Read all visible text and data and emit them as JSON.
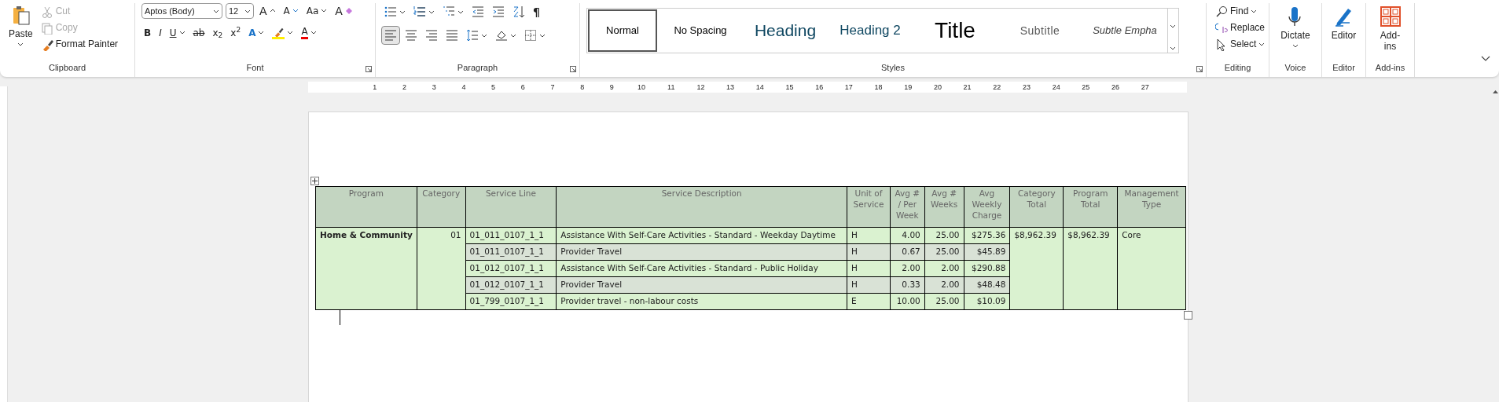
{
  "ribbon": {
    "clipboard": {
      "label": "Clipboard",
      "paste": "Paste",
      "cut": {
        "label": "Cut",
        "disabled": true
      },
      "copy": {
        "label": "Copy",
        "disabled": true
      },
      "format_painter": {
        "label": "Format Painter",
        "disabled": false
      }
    },
    "font": {
      "label": "Font",
      "font_name": "Aptos (Body)",
      "font_size": "12",
      "top_buttons": [
        {
          "kind": "grow",
          "glyph": "A"
        },
        {
          "kind": "shrink",
          "glyph": "A"
        },
        {
          "kind": "case",
          "glyph": "Aa"
        },
        {
          "kind": "clear",
          "glyph": "A"
        }
      ],
      "format_buttons": [
        {
          "kind": "bold",
          "glyph": "B"
        },
        {
          "kind": "italic",
          "glyph": "I"
        },
        {
          "kind": "underline",
          "glyph": "U"
        },
        {
          "kind": "strike",
          "glyph": "ab"
        },
        {
          "kind": "subscript",
          "glyph": "x$_{2}$"
        },
        {
          "kind": "superscript",
          "glyph": "x$^{2}$"
        },
        {
          "kind": "effects",
          "glyph": "A"
        },
        {
          "kind": "highlight"
        },
        {
          "kind": "color",
          "glyph": "A"
        }
      ]
    },
    "paragraph": {
      "label": "Paragraph",
      "pilcrow": "¶",
      "alignment": [
        {
          "kind": "left",
          "selected": true
        },
        {
          "kind": "center",
          "selected": false
        },
        {
          "kind": "right",
          "selected": false
        },
        {
          "kind": "justify",
          "selected": false
        }
      ]
    },
    "styles": {
      "label": "Styles",
      "items": [
        {
          "kind": "normal",
          "label": "Normal",
          "selected": true
        },
        {
          "kind": "no_spacing",
          "label": "No Spacing",
          "selected": false
        },
        {
          "kind": "heading1",
          "label": "Heading",
          "selected": false
        },
        {
          "kind": "heading2",
          "label": "Heading 2",
          "selected": false
        },
        {
          "kind": "title",
          "label": "Title",
          "selected": false
        },
        {
          "kind": "subtitle",
          "label": "Subtitle",
          "selected": false
        },
        {
          "kind": "subtle_emphasis",
          "label": "Subtle Empha",
          "selected": false
        }
      ]
    },
    "editing": {
      "label": "Editing",
      "items": [
        {
          "kind": "find",
          "label": "Find"
        },
        {
          "kind": "replace",
          "label": "Replace"
        },
        {
          "kind": "select",
          "label": "Select"
        }
      ]
    },
    "voice": {
      "label": "Voice",
      "button": "Dictate"
    },
    "editor": {
      "label": "Editor",
      "button": "Editor"
    },
    "addins": {
      "label": "Add-ins",
      "button": "Add-ins"
    }
  },
  "ruler": {
    "numbers": [
      "1",
      "2",
      "3",
      "4",
      "5",
      "6",
      "7",
      "8",
      "9",
      "10",
      "11",
      "12",
      "13",
      "14",
      "15",
      "16",
      "17",
      "18",
      "19",
      "20",
      "21",
      "22",
      "23",
      "24",
      "25",
      "26",
      "27"
    ]
  },
  "table": {
    "columns": [
      "Program",
      "Category",
      "Service Line",
      "Service Description",
      "Unit of Service",
      "Avg # / Per Week",
      "Avg # Weeks",
      "Avg Weekly Charge",
      "Category Total",
      "Program Total",
      "Management Type"
    ],
    "program": "Home & Community",
    "category": "01",
    "category_total": "$8,962.39",
    "program_total": "$8,962.39",
    "management_type": "Core",
    "rows": [
      {
        "service_line": "01_011_0107_1_1",
        "description": "Assistance With Self-Care Activities - Standard - Weekday Daytime",
        "unit": "H",
        "per_week": "4.00",
        "weeks": "25.00",
        "charge": "$275.36"
      },
      {
        "service_line": "01_011_0107_1_1",
        "description": "Provider Travel",
        "unit": "H",
        "per_week": "0.67",
        "weeks": "25.00",
        "charge": "$45.89"
      },
      {
        "service_line": "01_012_0107_1_1",
        "description": "Assistance With Self-Care Activities - Standard - Public Holiday",
        "unit": "H",
        "per_week": "2.00",
        "weeks": "2.00",
        "charge": "$290.88"
      },
      {
        "service_line": "01_012_0107_1_1",
        "description": "Provider Travel",
        "unit": "H",
        "per_week": "0.33",
        "weeks": "2.00",
        "charge": "$48.48"
      },
      {
        "service_line": "01_799_0107_1_1",
        "description": "Provider travel - non-labour costs",
        "unit": "E",
        "per_week": "10.00",
        "weeks": "25.00",
        "charge": "$10.09"
      }
    ]
  }
}
